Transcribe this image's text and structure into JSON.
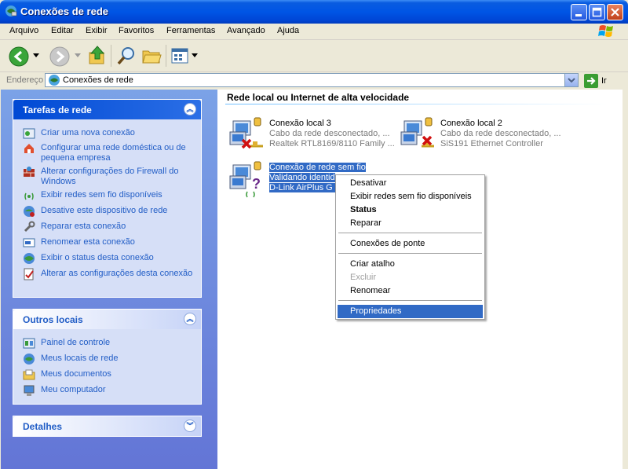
{
  "window": {
    "title": "Conexões de rede"
  },
  "menu": [
    "Arquivo",
    "Editar",
    "Exibir",
    "Favoritos",
    "Ferramentas",
    "Avançado",
    "Ajuda"
  ],
  "address": {
    "label": "Endereço",
    "value": "Conexões de rede",
    "go": "Ir"
  },
  "tasks_panel": {
    "title": "Tarefas de rede",
    "items": [
      {
        "label": "Criar uma nova conexão",
        "icon": "new-connection-icon"
      },
      {
        "label": "Configurar uma rede doméstica ou de pequena empresa",
        "icon": "home-network-icon"
      },
      {
        "label": "Alterar configurações do Firewall do Windows",
        "icon": "firewall-icon"
      },
      {
        "label": "Exibir redes sem fio disponíveis",
        "icon": "wireless-icon"
      },
      {
        "label": "Desative este dispositivo de rede",
        "icon": "disable-device-icon"
      },
      {
        "label": "Reparar esta conexão",
        "icon": "repair-icon"
      },
      {
        "label": "Renomear esta conexão",
        "icon": "rename-icon"
      },
      {
        "label": "Exibir o status desta conexão",
        "icon": "status-icon"
      },
      {
        "label": "Alterar as configurações desta conexão",
        "icon": "settings-icon"
      }
    ]
  },
  "places_panel": {
    "title": "Outros locais",
    "items": [
      {
        "label": "Painel de controle",
        "icon": "control-panel-icon"
      },
      {
        "label": "Meus locais de rede",
        "icon": "network-places-icon"
      },
      {
        "label": "Meus documentos",
        "icon": "documents-icon"
      },
      {
        "label": "Meu computador",
        "icon": "computer-icon"
      }
    ]
  },
  "details_panel": {
    "title": "Detalhes"
  },
  "content": {
    "section_title": "Rede local ou Internet de alta velocidade",
    "connections": [
      {
        "name": "Conexão local 3",
        "status": "Cabo da rede desconectado, ...",
        "device": "Realtek RTL8169/8110 Family ..."
      },
      {
        "name": "Conexão local 2",
        "status": "Cabo da rede desconectado, ...",
        "device": "SiS191 Ethernet Controller"
      },
      {
        "name": "Conexão de rede sem fio",
        "status": "Validando identid",
        "device": "D-Link AirPlus G D"
      }
    ]
  },
  "context_menu": {
    "items": [
      {
        "label": "Desativar"
      },
      {
        "label": "Exibir redes sem fio disponíveis"
      },
      {
        "label": "Status"
      },
      {
        "label": "Reparar"
      },
      {
        "label": "Conexões de ponte"
      },
      {
        "label": "Criar atalho"
      },
      {
        "label": "Excluir"
      },
      {
        "label": "Renomear"
      },
      {
        "label": "Propriedades"
      }
    ]
  },
  "colors": {
    "title_bar": "#0055e5",
    "selection": "#316ac5",
    "task_link": "#215dc6",
    "left_pane": "#6f8fdf"
  }
}
